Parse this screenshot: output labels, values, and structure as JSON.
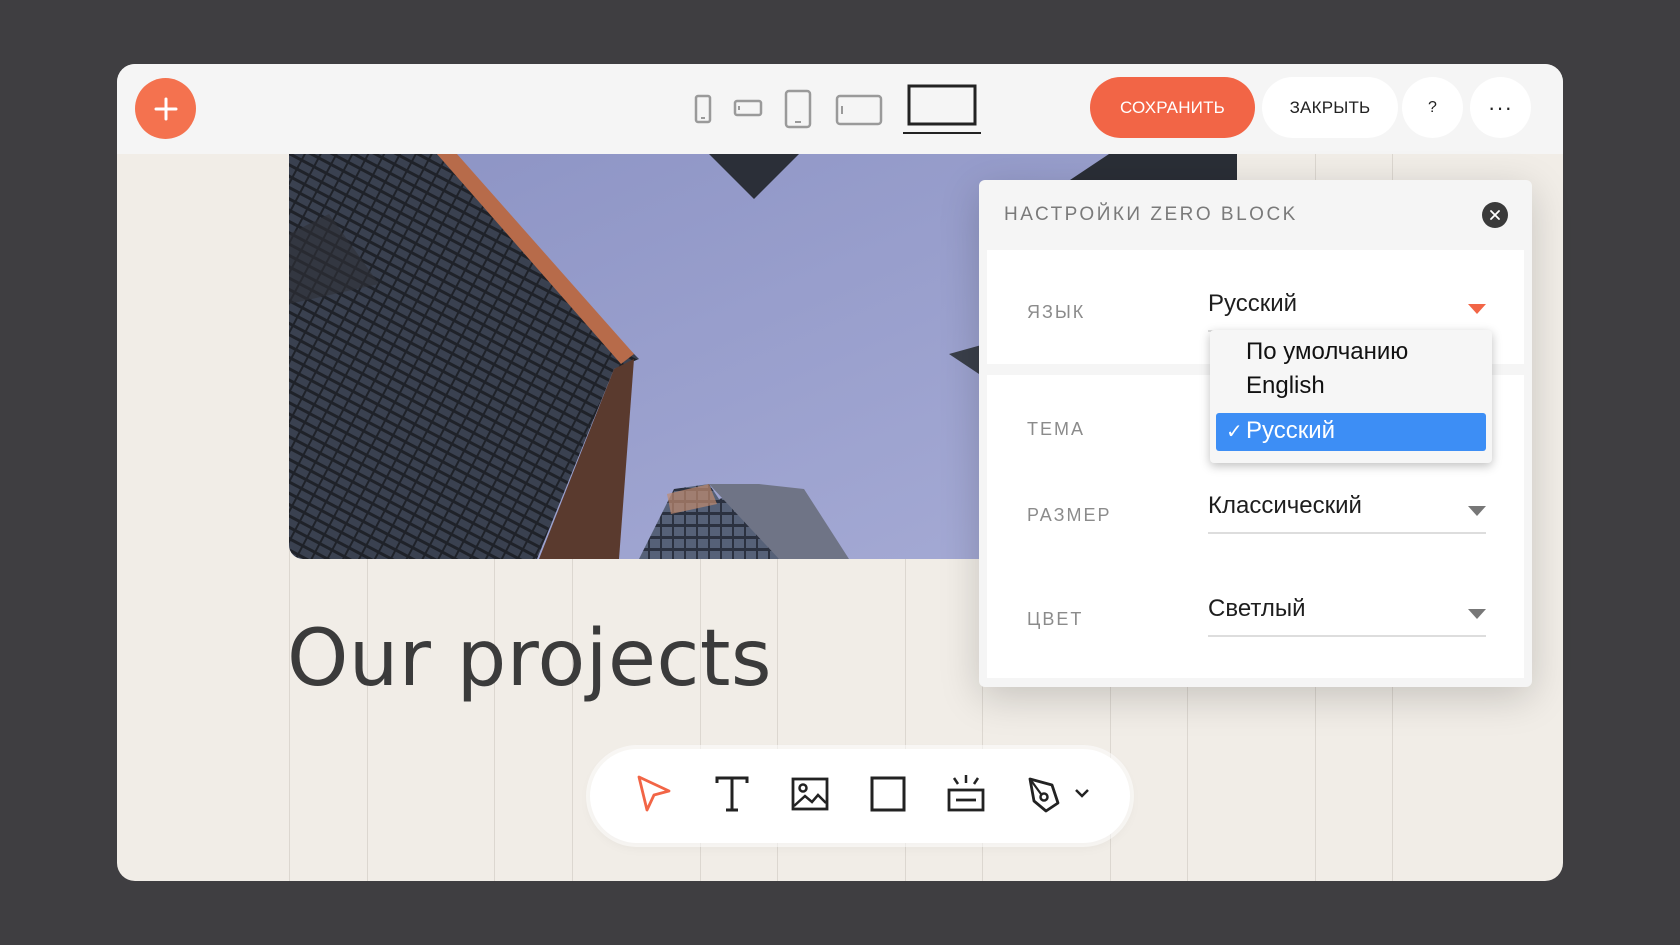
{
  "topbar": {
    "add_icon": "plus-icon",
    "devices": [
      "phone-portrait-icon",
      "phone-landscape-icon",
      "tablet-portrait-icon",
      "tablet-landscape-icon",
      "laptop-icon"
    ],
    "active_device": "laptop-icon",
    "save_label": "СОХРАНИТЬ",
    "close_label": "ЗАКРЫТЬ",
    "help_label": "?",
    "more_label": "···"
  },
  "canvas": {
    "heading": "Our projects"
  },
  "settings": {
    "title": "НАСТРОЙКИ ZERO BLOCK",
    "language": {
      "label": "ЯЗЫК",
      "value": "Русский"
    },
    "theme": {
      "label": "ТЕМА"
    },
    "size": {
      "label": "РАЗМЕР",
      "value": "Классический"
    },
    "color": {
      "label": "ЦВЕТ",
      "value": "Светлый"
    }
  },
  "language_dropdown": {
    "options": [
      "По умолчанию",
      "English",
      "Русский"
    ],
    "check": "✓",
    "selected": "Русский"
  },
  "toolbar": {
    "tools": [
      "cursor-icon",
      "text-icon",
      "image-icon",
      "shape-icon",
      "button-icon",
      "pen-icon"
    ],
    "active": "cursor-icon",
    "more_icon": "chevron-down-icon"
  },
  "colors": {
    "accent": "#f26546",
    "selection": "#3d8ef5",
    "background": "#3f3e41",
    "canvas": "#f1ede7"
  }
}
